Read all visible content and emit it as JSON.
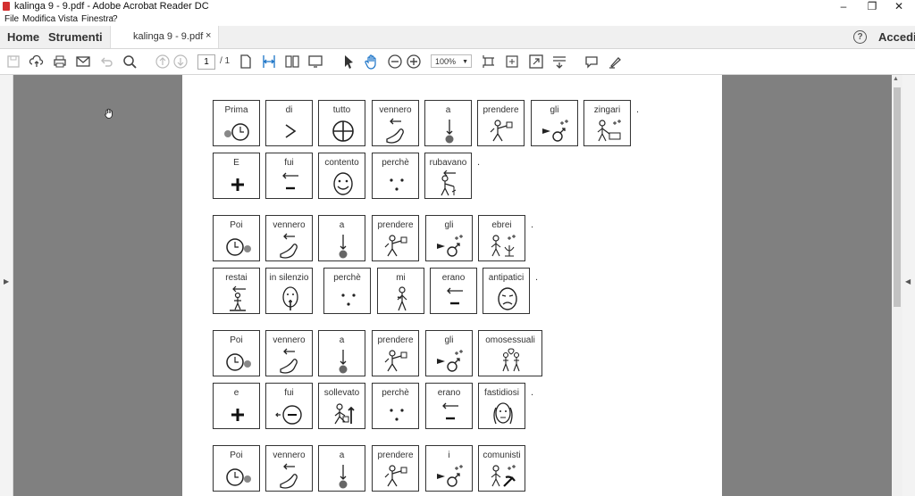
{
  "window": {
    "title": "kalinga 9 - 9.pdf - Adobe Acrobat Reader DC",
    "controls": [
      "–",
      "❐",
      "✕"
    ]
  },
  "menu": [
    "File",
    "Modifica",
    "Vista",
    "Finestra",
    "?"
  ],
  "tabs": {
    "home": "Home",
    "tools": "Strumenti",
    "document": "kalinga 9 - 9.pdf",
    "close": "×",
    "help": "?",
    "signin": "Accedi"
  },
  "toolbar": {
    "page_current": "1",
    "page_total": "/ 1",
    "zoom": "100%",
    "icons": [
      "save-icon",
      "upload-cloud-icon",
      "print-icon",
      "email-icon",
      "undo-icon",
      "search-icon",
      "page-up-icon",
      "page-down-icon",
      "single-page-icon",
      "fit-width-icon",
      "two-page-icon",
      "presentation-icon",
      "select-arrow-icon",
      "hand-tool-icon",
      "zoom-out-icon",
      "zoom-in-icon",
      "crop-icon",
      "fit-page-icon",
      "full-screen-icon",
      "scroll-icon",
      "comment-icon",
      "highlight-icon"
    ]
  },
  "colors": {
    "chrome": "#f0f0f0",
    "canvas": "#808080",
    "page": "#ffffff",
    "pdf_red": "#d32f2f"
  },
  "document": {
    "rows": [
      {
        "cells": [
          {
            "word": "Prima",
            "symbol": "clock-before"
          },
          {
            "word": "di",
            "symbol": "greater-than"
          },
          {
            "word": "tutto",
            "symbol": "circle-cross"
          },
          {
            "word": "vennero",
            "symbol": "hand-arrow"
          },
          {
            "word": "a",
            "symbol": "arrow-down-dot"
          },
          {
            "word": "prendere",
            "symbol": "person-grab"
          },
          {
            "word": "gli",
            "symbol": "arrow-male"
          },
          {
            "word": "zingari",
            "symbol": "person-cart"
          }
        ],
        "period": "."
      },
      {
        "cells": [
          {
            "word": "E",
            "symbol": "plus"
          },
          {
            "word": "fui",
            "symbol": "arrow-minus"
          },
          {
            "word": "contento",
            "symbol": "happy-face"
          },
          {
            "word": "perchè",
            "symbol": "three-dots"
          },
          {
            "word": "rubavano",
            "symbol": "person-arrow"
          }
        ],
        "period": "."
      },
      {
        "cells": [
          {
            "word": "Poi",
            "symbol": "clock-after"
          },
          {
            "word": "vennero",
            "symbol": "hand-arrow"
          },
          {
            "word": "a",
            "symbol": "arrow-down-dot"
          },
          {
            "word": "prendere",
            "symbol": "person-grab"
          },
          {
            "word": "gli",
            "symbol": "arrow-male"
          },
          {
            "word": "ebrei",
            "symbol": "person-menorah"
          }
        ],
        "period": "."
      },
      {
        "cells": [
          {
            "word": "restai",
            "symbol": "person-stand"
          },
          {
            "word": "in silenzio",
            "symbol": "face-hush"
          },
          {
            "word": "perchè",
            "symbol": "three-dots"
          },
          {
            "word": "mi",
            "symbol": "person-self"
          },
          {
            "word": "erano",
            "symbol": "arrow-minus"
          },
          {
            "word": "antipatici",
            "symbol": "sad-face"
          }
        ],
        "period": "."
      },
      {
        "cells": [
          {
            "word": "Poi",
            "symbol": "clock-after"
          },
          {
            "word": "vennero",
            "symbol": "hand-arrow"
          },
          {
            "word": "a",
            "symbol": "arrow-down-dot"
          },
          {
            "word": "prendere",
            "symbol": "person-grab"
          },
          {
            "word": "gli",
            "symbol": "arrow-male"
          },
          {
            "word": "omosessuali",
            "symbol": "two-persons"
          }
        ],
        "period": ""
      },
      {
        "cells": [
          {
            "word": "e",
            "symbol": "plus"
          },
          {
            "word": "fui",
            "symbol": "arrow-circle-minus"
          },
          {
            "word": "sollevato",
            "symbol": "person-up"
          },
          {
            "word": "perchè",
            "symbol": "three-dots"
          },
          {
            "word": "erano",
            "symbol": "arrow-minus"
          },
          {
            "word": "fastidiosi",
            "symbol": "face-hands"
          }
        ],
        "period": "."
      },
      {
        "cells": [
          {
            "word": "Poi",
            "symbol": "clock-after"
          },
          {
            "word": "vennero",
            "symbol": "hand-arrow"
          },
          {
            "word": "a",
            "symbol": "arrow-down-dot"
          },
          {
            "word": "prendere",
            "symbol": "person-grab"
          },
          {
            "word": "i",
            "symbol": "arrow-male"
          },
          {
            "word": "comunisti",
            "symbol": "person-hammer-sickle"
          }
        ],
        "period": ""
      }
    ]
  }
}
